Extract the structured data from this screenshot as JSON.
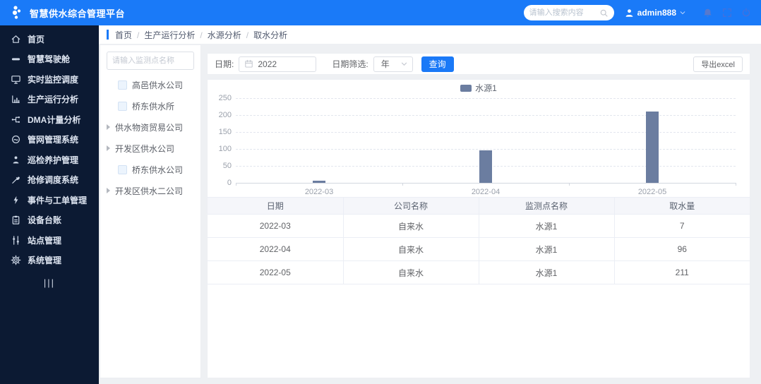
{
  "header": {
    "title": "智慧供水综合管理平台",
    "search_placeholder": "请输入搜索内容",
    "username": "admin888"
  },
  "breadcrumb": {
    "items": [
      "首页",
      "生产运行分析",
      "水源分析",
      "取水分析"
    ],
    "separator": "/"
  },
  "sidebar": {
    "items": [
      {
        "label": "首页",
        "icon": "home-icon"
      },
      {
        "label": "智慧驾驶舱",
        "icon": "dashboard-icon"
      },
      {
        "label": "实时监控调度",
        "icon": "monitor-icon"
      },
      {
        "label": "生产运行分析",
        "icon": "chart-icon"
      },
      {
        "label": "DMA计量分析",
        "icon": "network-icon"
      },
      {
        "label": "管网管理系统",
        "icon": "pipe-network-icon"
      },
      {
        "label": "巡检养护管理",
        "icon": "patrol-icon"
      },
      {
        "label": "抢修调度系统",
        "icon": "repair-icon"
      },
      {
        "label": "事件与工单管理",
        "icon": "event-icon"
      },
      {
        "label": "设备台账",
        "icon": "device-icon"
      },
      {
        "label": "站点管理",
        "icon": "station-icon"
      },
      {
        "label": "系统管理",
        "icon": "gear-icon"
      }
    ],
    "collapse_label": "|||"
  },
  "tree_panel": {
    "search_placeholder": "请输入监测点名称",
    "items": [
      {
        "label": "高邑供水公司",
        "type": "checkbox"
      },
      {
        "label": "桥东供水所",
        "type": "checkbox"
      },
      {
        "label": "供水物资贸易公司",
        "type": "expand"
      },
      {
        "label": "开发区供水公司",
        "type": "expand"
      },
      {
        "label": "桥东供水公司",
        "type": "checkbox"
      },
      {
        "label": "开发区供水二公司",
        "type": "expand"
      }
    ]
  },
  "filter_bar": {
    "date_label": "日期:",
    "date_value": "2022",
    "filter_label": "日期筛选:",
    "filter_value": "年",
    "query_button": "查询",
    "export_button": "导出excel"
  },
  "chart_data": {
    "type": "bar",
    "categories": [
      "2022-03",
      "2022-04",
      "2022-05"
    ],
    "series": [
      {
        "name": "水源1",
        "values": [
          7,
          96,
          211
        ]
      }
    ],
    "ylim": [
      0,
      250
    ],
    "ytick_step": 50,
    "bar_color": "#6b7da0",
    "grid": true,
    "legend_position": "top-center"
  },
  "table": {
    "headers": [
      "日期",
      "公司名称",
      "监测点名称",
      "取水量"
    ],
    "rows": [
      [
        "2022-03",
        "自来水",
        "水源1",
        "7"
      ],
      [
        "2022-04",
        "自来水",
        "水源1",
        "96"
      ],
      [
        "2022-05",
        "自来水",
        "水源1",
        "211"
      ]
    ]
  },
  "colors": {
    "header_bg": "#1a7af8",
    "sidebar_bg": "#0c1a33",
    "accent": "#1a79f7",
    "bar": "#6b7da0"
  }
}
